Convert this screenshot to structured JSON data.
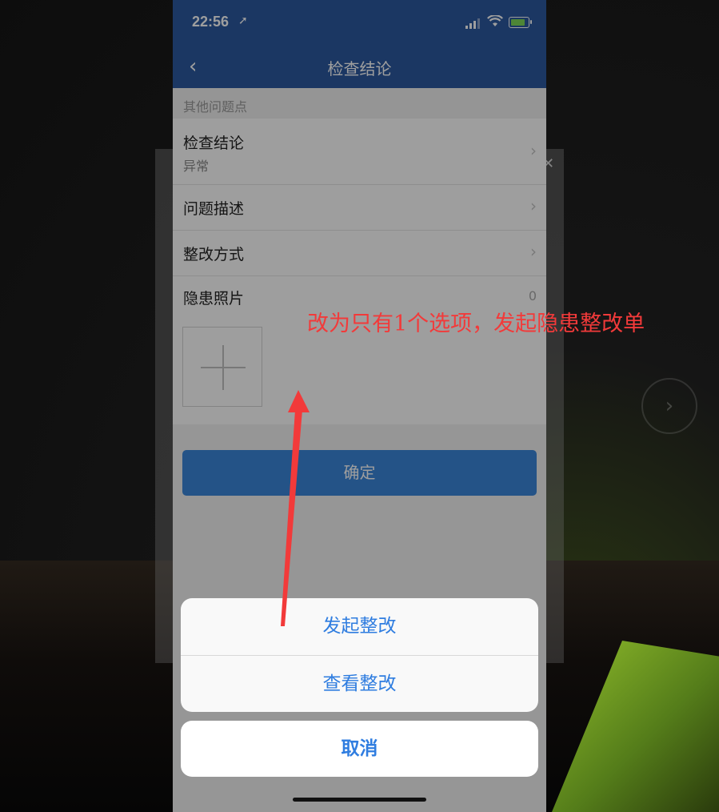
{
  "status": {
    "time": "22:56"
  },
  "nav": {
    "title": "检查结论"
  },
  "section": {
    "header": "其他问题点"
  },
  "rows": [
    {
      "label": "检查结论",
      "value": "异常"
    },
    {
      "label": "问题描述"
    },
    {
      "label": "整改方式"
    }
  ],
  "photos": {
    "label": "隐患照片",
    "count": "0"
  },
  "confirm": {
    "label": "确定"
  },
  "action_sheet": {
    "options": [
      "发起整改",
      "查看整改"
    ],
    "cancel": "取消"
  },
  "annotation": {
    "text": "改为只有1个选项，发起隐患整改单",
    "color": "#f23a3a"
  },
  "colors": {
    "nav": "#2c5aa0",
    "accent": "#2f7de0",
    "button": "#3a86da"
  }
}
